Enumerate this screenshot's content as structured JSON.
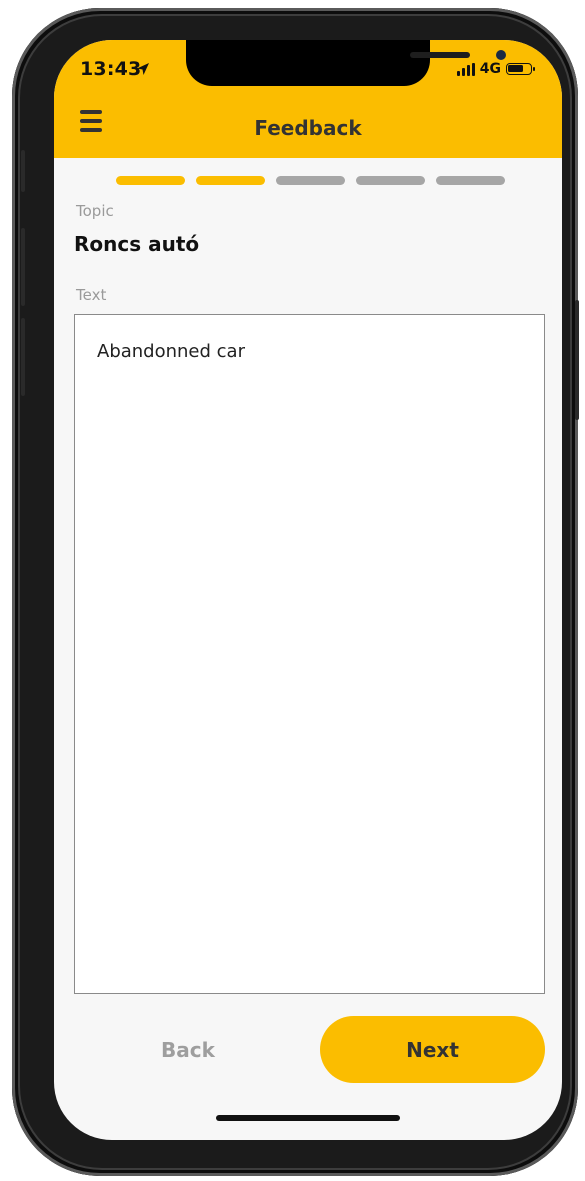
{
  "status_bar": {
    "time": "13:43",
    "network": "4G",
    "battery_level": 0.75
  },
  "header": {
    "title": "Feedback"
  },
  "progress": {
    "total_steps": 5,
    "current_step": 2,
    "active_color": "#fbbd00",
    "inactive_color": "#a6a6a6"
  },
  "form": {
    "topic_label": "Topic",
    "topic_value": "Roncs autó",
    "text_label": "Text",
    "text_value": "Abandonned car"
  },
  "buttons": {
    "back_label": "Back",
    "next_label": "Next"
  },
  "colors": {
    "accent": "#fbbd00",
    "background": "#f7f7f7"
  },
  "icons": {
    "menu": "hamburger-menu-icon",
    "location": "location-arrow-icon",
    "battery": "battery-icon",
    "signal": "signal-icon"
  }
}
